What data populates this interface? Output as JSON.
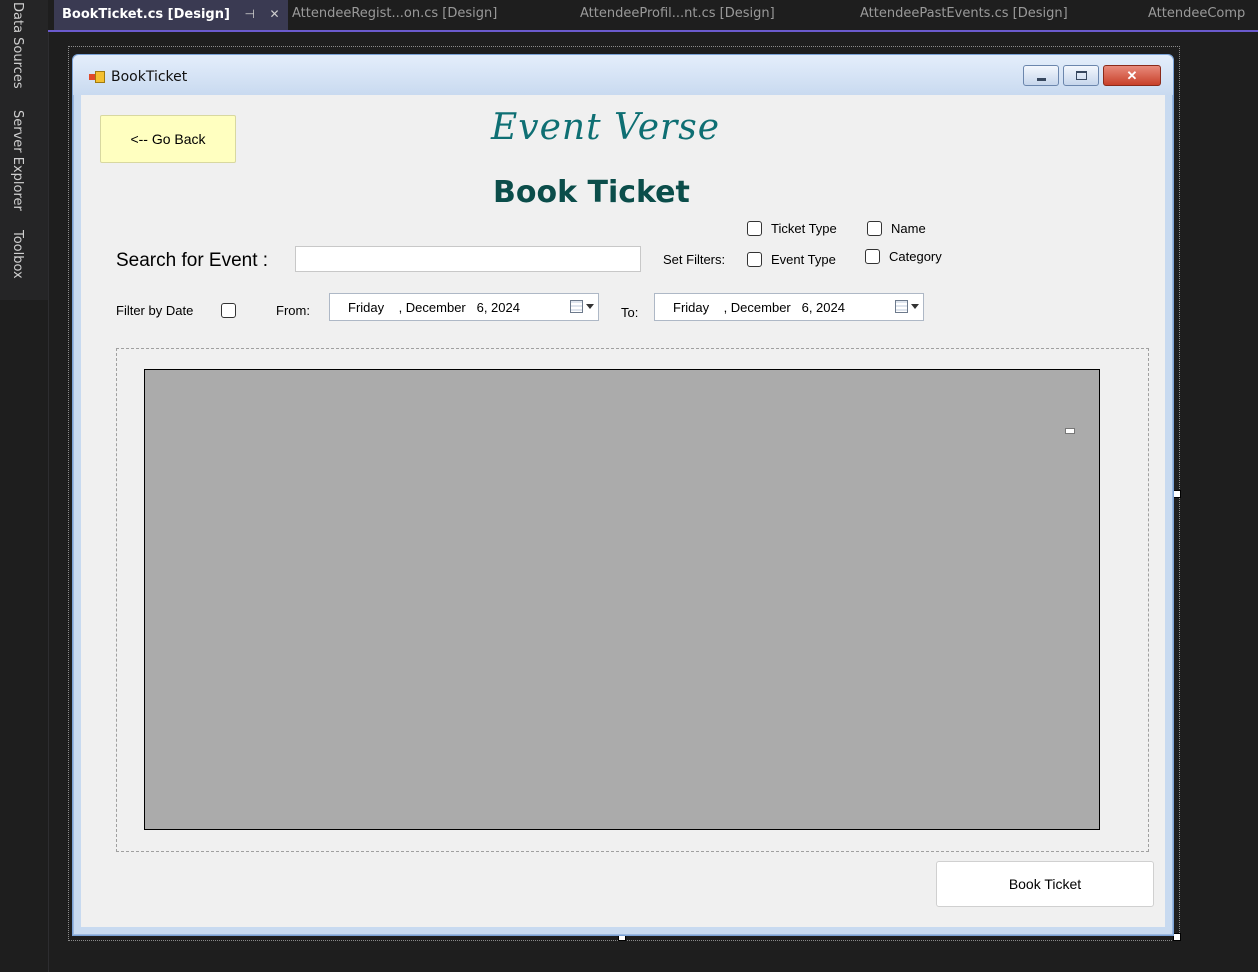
{
  "ide": {
    "side_tabs": [
      "Data Sources",
      "Server Explorer",
      "Toolbox"
    ],
    "doc_tabs": [
      {
        "label": "BookTicket.cs [Design]",
        "active": true
      },
      {
        "label": "AttendeeRegist...on.cs [Design]",
        "active": false
      },
      {
        "label": "AttendeeProfil...nt.cs [Design]",
        "active": false
      },
      {
        "label": "AttendeePastEvents.cs [Design]",
        "active": false
      },
      {
        "label": "AttendeeComp",
        "active": false
      }
    ],
    "tab_pin_glyph": "⊣",
    "tab_close_glyph": "✕",
    "accent": "#6a5acd"
  },
  "window": {
    "title": "BookTicket",
    "close_glyph": "✕"
  },
  "form": {
    "go_back_label": "<-- Go Back",
    "brand": "Event Verse",
    "title": "Book Ticket",
    "search_label": "Search for Event :",
    "search_value": "",
    "set_filters_label": "Set Filters:",
    "filters": {
      "ticket_type": "Ticket Type",
      "name": "Name",
      "event_type": "Event Type",
      "category": "Category"
    },
    "filter_by_date_label": "Filter by Date",
    "from_label": "From:",
    "to_label": "To:",
    "from_date": "Friday    , December   6, 2024",
    "to_date": "Friday    , December   6, 2024",
    "book_button_label": "Book Ticket",
    "colors": {
      "brand": "#0e6f73",
      "title": "#0b4d4a",
      "go_back_bg": "#ffffc0",
      "grid_bg": "#ababab"
    }
  }
}
